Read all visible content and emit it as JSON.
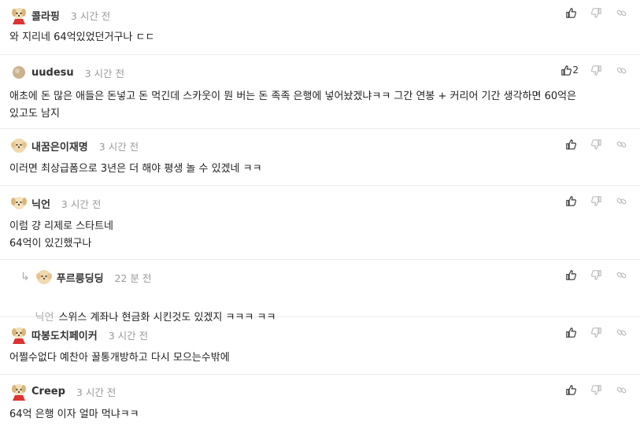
{
  "comments": [
    {
      "nick": "콜라핑",
      "time": "3 시간 전",
      "avatar": "dog-red",
      "text": "와 지리네 64억있었던거구나 ㄷㄷ",
      "likes": ""
    },
    {
      "nick": "uudesu",
      "time": "3 시간 전",
      "avatar": "ball",
      "text": "애초에 돈 많은 애들은 돈넣고 돈 먹긴데 스카웃이 뭔 버는 돈 족족 은행에 넣어놨겠냐ㅋㅋ 그간 연봉 + 커리어 기간 생각하면 60억은\n있고도 남지",
      "likes": "2"
    },
    {
      "nick": "내꿈은이재명",
      "time": "3 시간 전",
      "avatar": "dog-fluffy",
      "text": "이러면 최상급폼으로 3년은 더 해야 평생 놀 수 있겠네 ㅋㅋ",
      "likes": ""
    },
    {
      "nick": "닉언",
      "time": "3 시간 전",
      "avatar": "dog-plain",
      "text": "이럼 걍 리제로 스타트네\n64억이 있긴했구나",
      "likes": ""
    },
    {
      "nick": "푸르릉딩딩",
      "time": "22 분 전",
      "avatar": "dog-fluffy",
      "mention": "닉언",
      "text": "스위스 계좌나 현금화 시킨것도 있겠지 ㅋㅋㅋ ㅋㅋ",
      "likes": "",
      "reply": true
    },
    {
      "nick": "따봉도치페이커",
      "time": "3 시간 전",
      "avatar": "dog-red",
      "text": "어쩔수없다 예찬아 꿀통개방하고 다시 모으는수밖에",
      "likes": ""
    },
    {
      "nick": "Creep",
      "time": "3 시간 전",
      "avatar": "dog-red",
      "text": "64억 은행 이자 얼마 먹냐ㅋㅋ",
      "likes": ""
    }
  ],
  "icons": {
    "like": "thumbs-up-icon",
    "dislike": "thumbs-down-icon",
    "share": "link-icon",
    "reply": "reply-arrow-icon"
  },
  "colors": {
    "muted": "#999999",
    "border": "#ececec",
    "text": "#222222"
  }
}
